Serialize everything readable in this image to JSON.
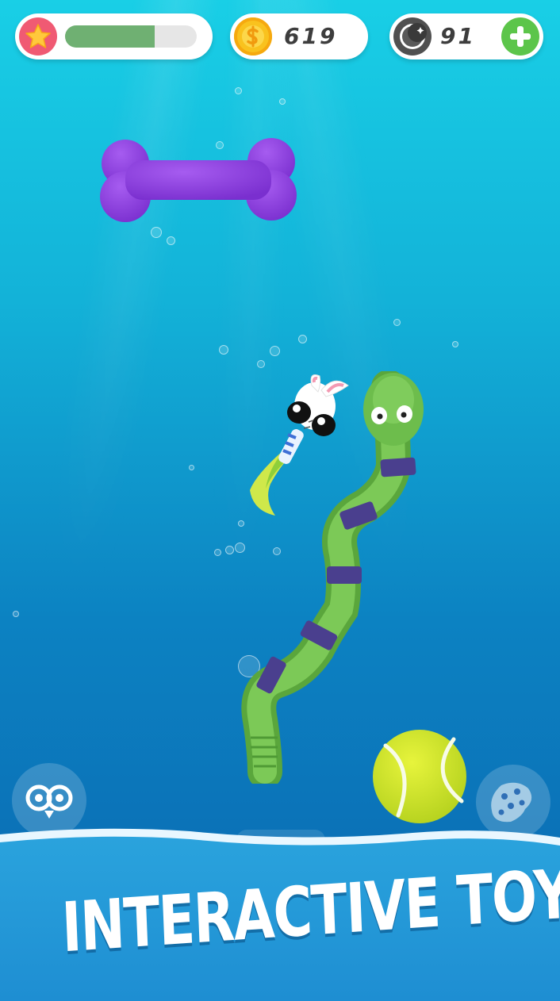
{
  "hud": {
    "xp_progress": 0.68,
    "coins": "619",
    "moons": "91",
    "colors": {
      "star_badge": "#f05a73",
      "xp_fill": "#6fb072",
      "coin": "#f9c21e",
      "plus": "#5cc54a"
    }
  },
  "icons": {
    "xp": "star-icon",
    "currency": "coin-dollar-icon",
    "premium": "moon-icon",
    "add": "plus-icon",
    "left_button": "eyes-icon",
    "right_button": "sponge-icon"
  },
  "scene": {
    "toys": [
      "bone-toy",
      "caterpillar-toy",
      "tennis-ball-toy"
    ],
    "pet": "bunny-eared-bug-pet",
    "colors": {
      "bone": "#8a3fdc",
      "caterpillar": "#66bb48",
      "stripe": "#4a3f8e",
      "ball": "#d4ea2a"
    }
  },
  "banner": {
    "title": "INTERACTIVE TOYS"
  }
}
